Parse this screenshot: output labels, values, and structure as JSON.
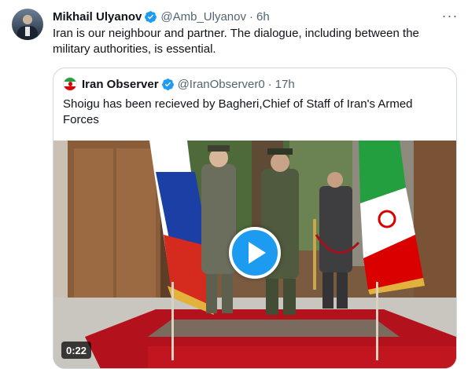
{
  "tweet": {
    "author_name": "Mikhail Ulyanov",
    "handle": "@Amb_Ulyanov",
    "separator": "·",
    "time": "6h",
    "more_label": "···",
    "text": "Iran is our neighbour and partner. The dialogue, including between the military authorities, is essential."
  },
  "quoted": {
    "author_name": "Iran Observer",
    "handle": "@IranObserver0",
    "separator": "·",
    "time": "17h",
    "text": "Shoigu has been recieved by Bagheri,Chief of Staff of Iran's Armed Forces",
    "video": {
      "duration": "0:22",
      "has_play_button": true
    }
  },
  "colors": {
    "accent": "#1d9bf0",
    "text_primary": "#0f1419",
    "text_secondary": "#536471",
    "border": "#cfd9de"
  },
  "icons": [
    "verified-badge-icon",
    "more-options-icon",
    "play-icon"
  ]
}
